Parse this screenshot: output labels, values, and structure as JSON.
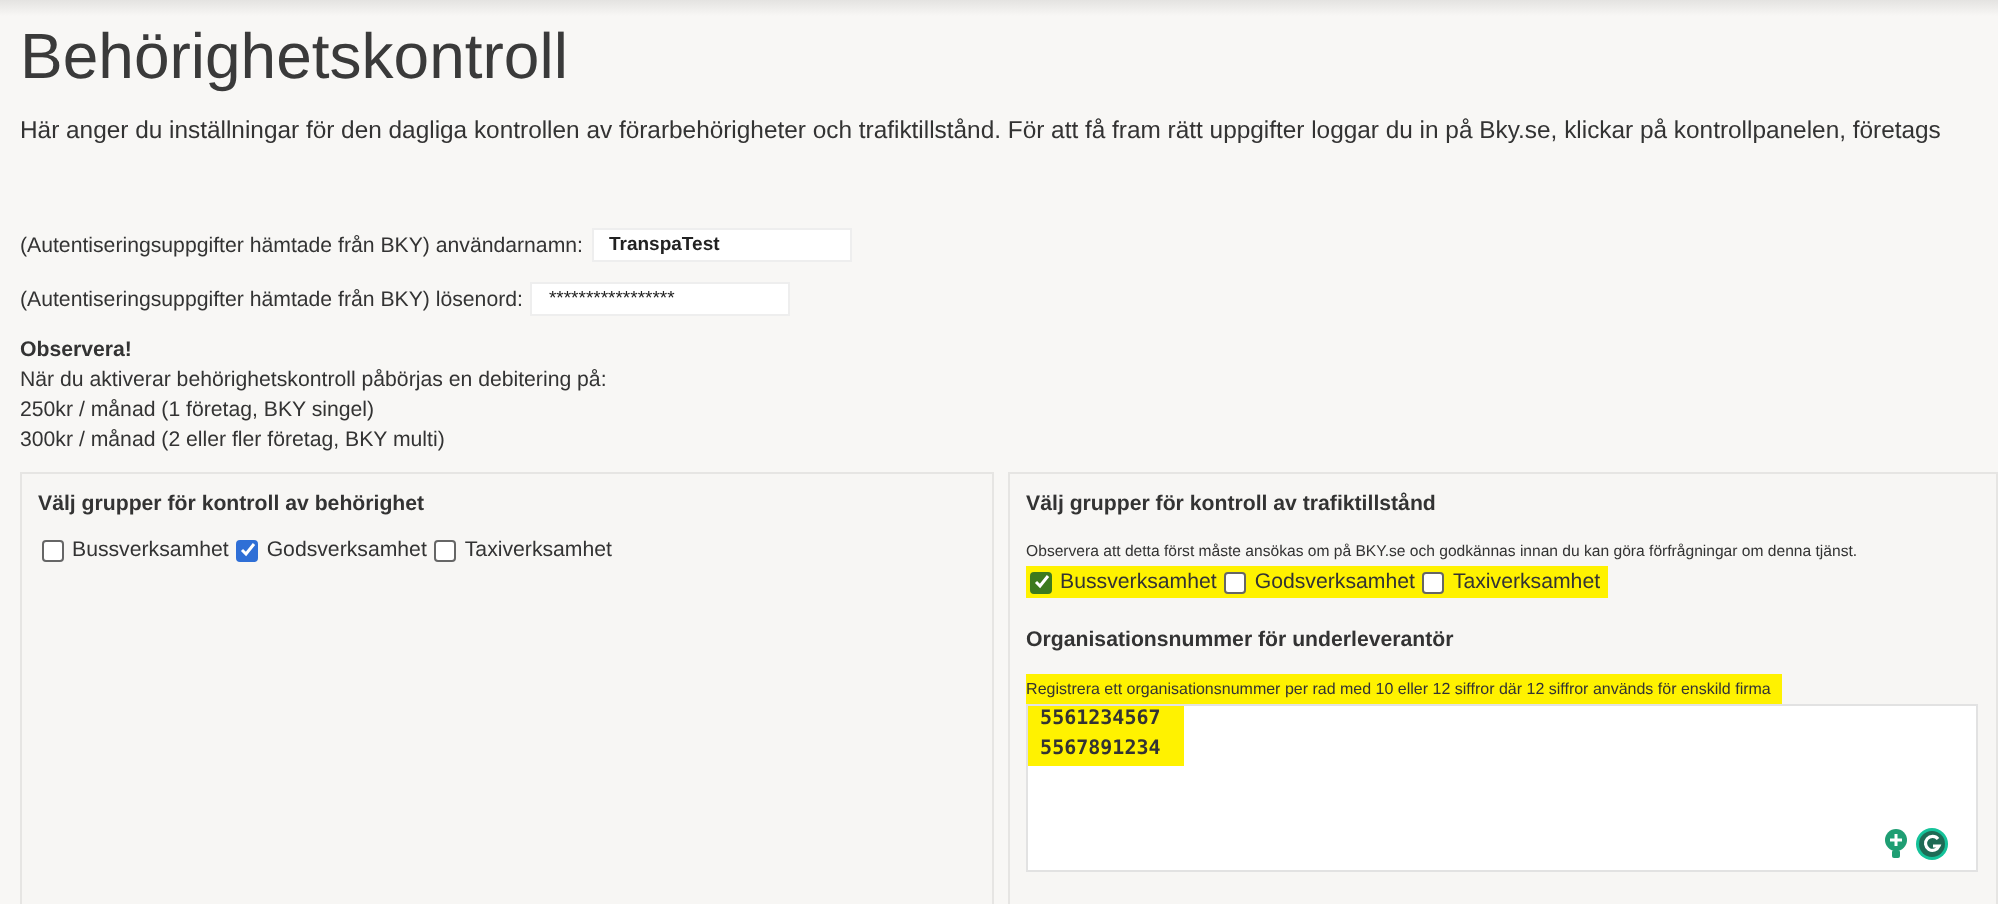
{
  "page": {
    "title": "Behörighetskontroll",
    "description": "Här anger du inställningar för den dagliga kontrollen av förarbehörigheter och trafiktillstånd. För att få fram rätt uppgifter loggar du in på Bky.se, klickar på kontrollpanelen, företags"
  },
  "credentials": [
    {
      "label": "(Autentiseringsuppgifter hämtade från BKY) användarnamn:",
      "value": "TranspaTest",
      "kind": "text"
    },
    {
      "label": "(Autentiseringsuppgifter hämtade från BKY) lösenord:",
      "value": "*****************",
      "kind": "password"
    }
  ],
  "notice": {
    "heading": "Observera!",
    "lines": [
      "När du aktiverar behörighetskontroll påbörjas en debitering på:",
      "250kr / månad (1 företag, BKY singel)",
      "300kr / månad (2 eller fler företag, BKY multi)"
    ]
  },
  "license_panel": {
    "heading": "Välj grupper för kontroll av behörighet",
    "groups": [
      {
        "label": "Bussverksamhet",
        "checked": false
      },
      {
        "label": "Godsverksamhet",
        "checked": true
      },
      {
        "label": "Taxiverksamhet",
        "checked": false
      }
    ]
  },
  "permit_panel": {
    "heading": "Välj grupper för kontroll av trafiktillstånd",
    "note": "Observera att detta först måste ansökas om på BKY.se och godkännas innan du kan göra förfrågningar om denna tjänst.",
    "groups_highlighted": true,
    "groups": [
      {
        "label": "Bussverksamhet",
        "checked": true
      },
      {
        "label": "Godsverksamhet",
        "checked": false
      },
      {
        "label": "Taxiverksamhet",
        "checked": false
      }
    ],
    "subheading": "Organisationsnummer för underleverantör",
    "hint": {
      "text": "Registrera ett organisationsnummer per rad med 10 eller 12 siffror där 12 siffror används för enskild firma",
      "highlighted": true
    },
    "org_numbers": [
      {
        "value": "5561234567",
        "highlighted": true
      },
      {
        "value": "5567891234",
        "highlighted": true
      }
    ]
  }
}
